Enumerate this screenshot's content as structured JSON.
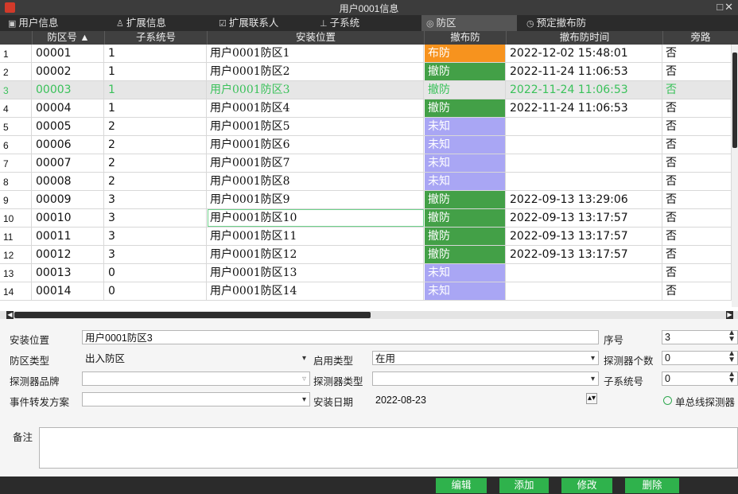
{
  "window": {
    "title": "用户0001信息",
    "app_icon": "app-logo-icon",
    "controls": "□✕"
  },
  "tabs": [
    {
      "icon": "card-icon",
      "glyph": "▣",
      "label": "用户信息"
    },
    {
      "icon": "users-icon",
      "glyph": "♙",
      "label": "扩展信息"
    },
    {
      "icon": "contact-icon",
      "glyph": "☑",
      "label": "扩展联系人"
    },
    {
      "icon": "tree-icon",
      "glyph": "⊥",
      "label": "子系统"
    },
    {
      "icon": "shield-icon",
      "glyph": "◎",
      "label": "防区",
      "active": true
    },
    {
      "icon": "clock-icon",
      "glyph": "◷",
      "label": "预定撤布防"
    }
  ],
  "grid": {
    "columns": [
      "防区号 ▲",
      "子系统号",
      "安装位置",
      "撤布防",
      "撤布防时间",
      "旁路"
    ],
    "rows": [
      {
        "n": "1",
        "zone": "00001",
        "sub": "1",
        "loc": "用户0001防区1",
        "state": "布防",
        "state_kind": "arm",
        "time": "2022-12-02 15:48:01",
        "bypass": "否"
      },
      {
        "n": "2",
        "zone": "00002",
        "sub": "1",
        "loc": "用户0001防区2",
        "state": "撤防",
        "state_kind": "disarm",
        "time": "2022-11-24 11:06:53",
        "bypass": "否"
      },
      {
        "n": "3",
        "zone": "00003",
        "sub": "1",
        "loc": "用户0001防区3",
        "state": "撤防",
        "state_kind": "selected",
        "time": "2022-11-24 11:06:53",
        "bypass": "否",
        "selected": true
      },
      {
        "n": "4",
        "zone": "00004",
        "sub": "1",
        "loc": "用户0001防区4",
        "state": "撤防",
        "state_kind": "disarm",
        "time": "2022-11-24 11:06:53",
        "bypass": "否"
      },
      {
        "n": "5",
        "zone": "00005",
        "sub": "2",
        "loc": "用户0001防区5",
        "state": "未知",
        "state_kind": "unknown",
        "time": "",
        "bypass": "否"
      },
      {
        "n": "6",
        "zone": "00006",
        "sub": "2",
        "loc": "用户0001防区6",
        "state": "未知",
        "state_kind": "unknown",
        "time": "",
        "bypass": "否"
      },
      {
        "n": "7",
        "zone": "00007",
        "sub": "2",
        "loc": "用户0001防区7",
        "state": "未知",
        "state_kind": "unknown",
        "time": "",
        "bypass": "否"
      },
      {
        "n": "8",
        "zone": "00008",
        "sub": "2",
        "loc": "用户0001防区8",
        "state": "未知",
        "state_kind": "unknown",
        "time": "",
        "bypass": "否"
      },
      {
        "n": "9",
        "zone": "00009",
        "sub": "3",
        "loc": "用户0001防区9",
        "state": "撤防",
        "state_kind": "disarm",
        "time": "2022-09-13 13:29:06",
        "bypass": "否"
      },
      {
        "n": "10",
        "zone": "00010",
        "sub": "3",
        "loc": "用户0001防区10",
        "state": "撤防",
        "state_kind": "disarm",
        "time": "2022-09-13 13:17:57",
        "bypass": "否",
        "focus": true
      },
      {
        "n": "11",
        "zone": "00011",
        "sub": "3",
        "loc": "用户0001防区11",
        "state": "撤防",
        "state_kind": "disarm",
        "time": "2022-09-13 13:17:57",
        "bypass": "否"
      },
      {
        "n": "12",
        "zone": "00012",
        "sub": "3",
        "loc": "用户0001防区12",
        "state": "撤防",
        "state_kind": "disarm",
        "time": "2022-09-13 13:17:57",
        "bypass": "否"
      },
      {
        "n": "13",
        "zone": "00013",
        "sub": "0",
        "loc": "用户0001防区13",
        "state": "未知",
        "state_kind": "unknown",
        "time": "",
        "bypass": "否"
      },
      {
        "n": "14",
        "zone": "00014",
        "sub": "0",
        "loc": "用户0001防区14",
        "state": "未知",
        "state_kind": "unknown",
        "time": "",
        "bypass": "否"
      }
    ]
  },
  "form": {
    "install_location_label": "安装位置",
    "install_location_value": "用户0001防区3",
    "seq_label": "序号",
    "seq_value": "3",
    "zone_type_label": "防区类型",
    "zone_type_value": "出入防区",
    "enable_type_label": "启用类型",
    "enable_type_value": "在用",
    "detector_count_label": "探测器个数",
    "detector_count_value": "0",
    "detector_brand_label": "探测器品牌",
    "detector_brand_value": "",
    "detector_type_label": "探测器类型",
    "detector_type_value": "",
    "subsystem_label": "子系统号",
    "subsystem_value": "0",
    "event_scheme_label": "事件转发方案",
    "event_scheme_value": "",
    "install_date_label": "安装日期",
    "install_date_value": "2022-08-23",
    "single_bus_label": "单总线探测器",
    "remark_label": "备注"
  },
  "buttons": {
    "edit": "编辑",
    "add": "添加",
    "modify": "修改",
    "delete": "删除"
  }
}
